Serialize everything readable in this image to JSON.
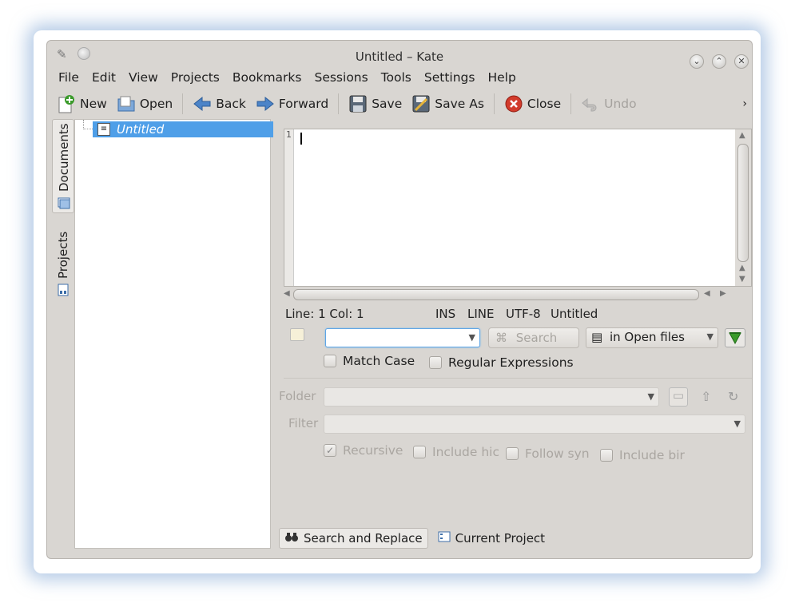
{
  "window": {
    "title": "Untitled – Kate"
  },
  "menubar": [
    {
      "label": "File"
    },
    {
      "label": "Edit"
    },
    {
      "label": "View"
    },
    {
      "label": "Projects"
    },
    {
      "label": "Bookmarks"
    },
    {
      "label": "Sessions"
    },
    {
      "label": "Tools"
    },
    {
      "label": "Settings"
    },
    {
      "label": "Help"
    }
  ],
  "toolbar": {
    "new": "New",
    "open": "Open",
    "back": "Back",
    "forward": "Forward",
    "save": "Save",
    "save_as": "Save As",
    "close": "Close",
    "undo": "Undo",
    "more": "›"
  },
  "sidebar_tabs": {
    "documents": "Documents",
    "projects": "Projects"
  },
  "documents": [
    {
      "name": "Untitled",
      "selected": true
    }
  ],
  "editor": {
    "line_number": "1"
  },
  "statusbar": {
    "position": "Line: 1 Col: 1",
    "mode": "INS",
    "selection_mode": "LINE",
    "encoding": "UTF-8",
    "filename": "Untitled"
  },
  "search": {
    "query": "",
    "search_button": "Search",
    "scope": "in Open files",
    "match_case": "Match Case",
    "regex": "Regular Expressions",
    "folder_label": "Folder",
    "filter_label": "Filter",
    "recursive": "Recursive",
    "include_hidden": "Include hic",
    "follow_symlinks": "Follow syn",
    "include_binary": "Include bir"
  },
  "bottom_tabs": {
    "search_replace": "Search and Replace",
    "current_project": "Current Project"
  },
  "colors": {
    "selection": "#4f9fe8",
    "close_red": "#d23b2b",
    "accent_green": "#3a9a2a"
  }
}
